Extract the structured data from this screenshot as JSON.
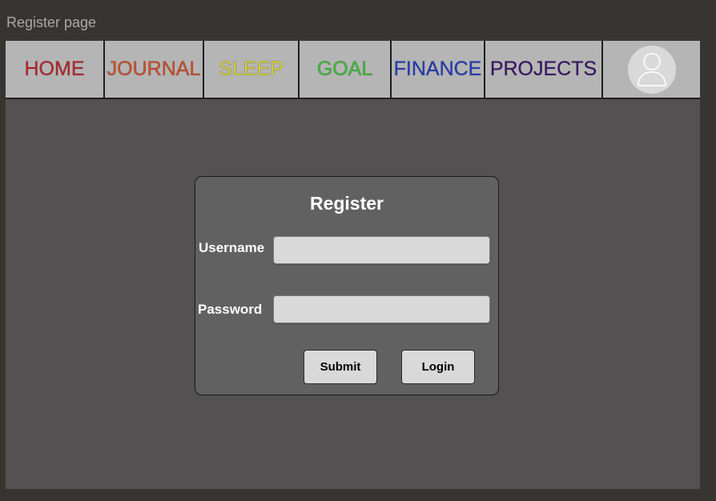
{
  "window": {
    "title": "Register page"
  },
  "nav": {
    "items": [
      {
        "label": "HOME",
        "color": "#c0262c"
      },
      {
        "label": "JOURNAL",
        "color": "#d4502a"
      },
      {
        "label": "SLEEP",
        "color": "#e0da38"
      },
      {
        "label": "GOAL",
        "color": "#3fc43a"
      },
      {
        "label": "FINANCE",
        "color": "#2440c4"
      },
      {
        "label": "PROJECTS",
        "color": "#3e1770"
      }
    ],
    "avatar_icon": "user-avatar-icon"
  },
  "form": {
    "title": "Register",
    "username_label": "Username",
    "username_value": "",
    "password_label": "Password",
    "password_value": "",
    "submit_label": "Submit",
    "login_label": "Login"
  },
  "colors": {
    "background": "#383432",
    "frame": "#535151",
    "navbar": "#b5b5b5",
    "card": "#616161",
    "input": "#d9d9d9"
  }
}
